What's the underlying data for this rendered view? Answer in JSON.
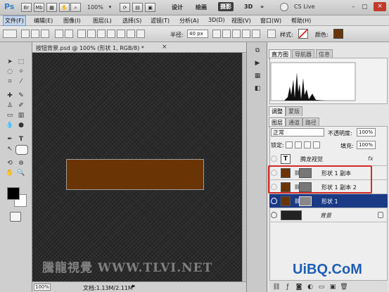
{
  "app": {
    "logo": "Ps",
    "bridge_buttons": [
      "Br",
      "Mb"
    ],
    "zoom": "100%",
    "workspaces": [
      "设计",
      "绘画",
      "摄影",
      "3D"
    ],
    "active_workspace": "摄影",
    "more_label": "»",
    "cslive": "CS Live"
  },
  "menubar": {
    "items": [
      "文件(F)",
      "编辑(E)",
      "图像(I)",
      "图层(L)",
      "选择(S)",
      "滤镜(T)",
      "分析(A)",
      "3D(D)",
      "视图(V)",
      "窗口(W)",
      "帮助(H)"
    ],
    "selected": "文件(F)"
  },
  "options": {
    "radius_label": "半径:",
    "radius_value": "40 px",
    "style_label": "样式:",
    "color_label": "颜色:",
    "color_value": "#6b3405"
  },
  "document": {
    "tab_title": "按钮背景.psd @ 100% (形状 1, RGB/8) *",
    "close": "×",
    "zoom": "100%",
    "doc_info": "文档:1.13M/2.11M",
    "watermark": "騰龍視覺 WWW.TLVI.NET"
  },
  "panels": {
    "top_tabs": [
      "直方图",
      "导航器",
      "信息"
    ],
    "mid_tabs": [
      "调整",
      "蒙版"
    ],
    "layer_tabs": [
      "图层",
      "通道",
      "路径"
    ],
    "blend_mode": "正常",
    "opacity_label": "不透明度:",
    "opacity_value": "100%",
    "lock_label": "锁定:",
    "fill_label": "填充:",
    "fill_value": "100%",
    "layers": [
      {
        "name": "腾龙视觉",
        "type": "text",
        "fx": "fx"
      },
      {
        "name": "形状 1 副本",
        "type": "shape"
      },
      {
        "name": "形状 1 副本 2",
        "type": "shape"
      },
      {
        "name": "形状 1",
        "type": "shape",
        "selected": true
      },
      {
        "name": "背景",
        "type": "background"
      }
    ]
  },
  "colors": {
    "shape_fill": "#6b3405",
    "selected_layer": "#1b3a86",
    "highlight_box": "#d32a2a"
  },
  "watermark2": "UiBQ.CoM"
}
